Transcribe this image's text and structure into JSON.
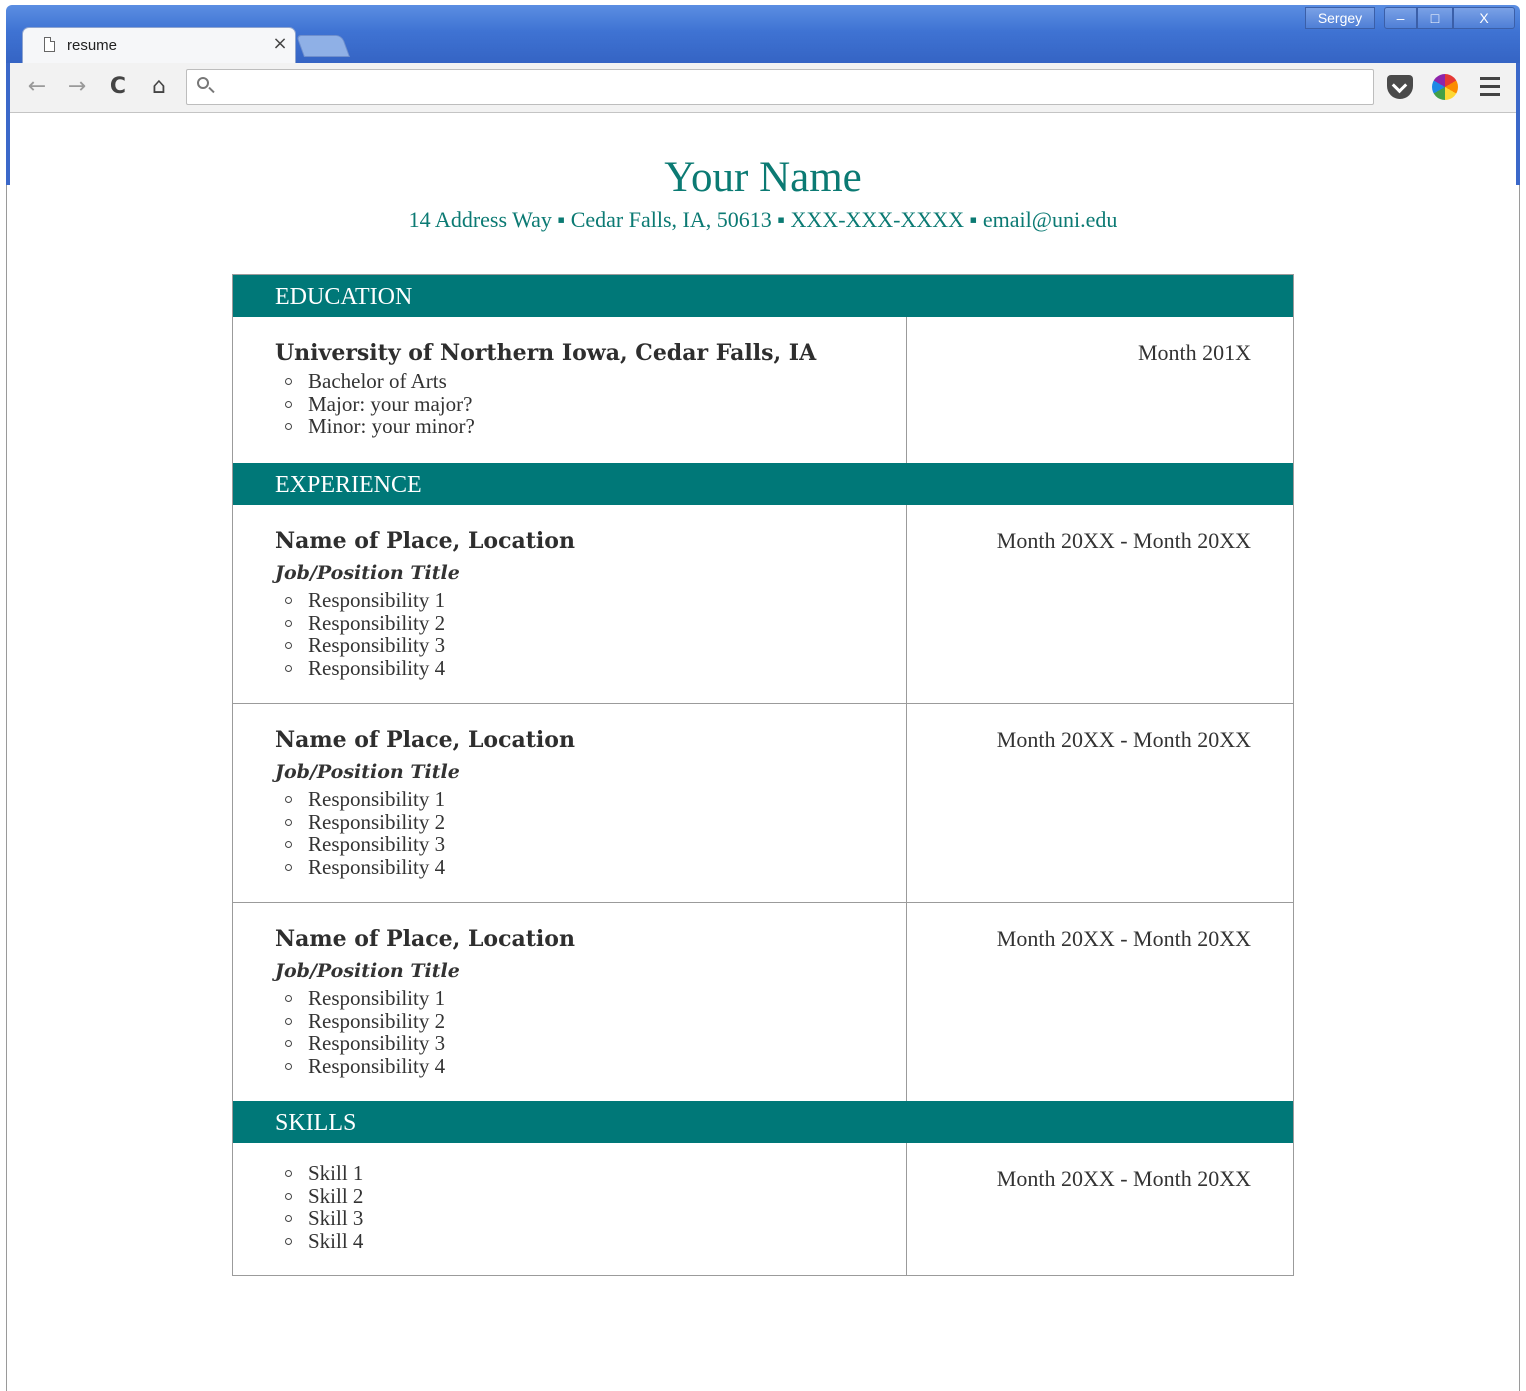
{
  "browser": {
    "tab_title": "resume",
    "tab_close": "×",
    "user_label": "Sergey",
    "min_label": "–",
    "max_label": "□",
    "close_label": "X",
    "back_glyph": "←",
    "forward_glyph": "→",
    "reload_glyph": "C",
    "home_glyph": "⌂",
    "address_value": "",
    "icons": [
      "page-icon",
      "search-icon",
      "pocket-icon",
      "color-picker-icon",
      "menu-icon"
    ]
  },
  "resume": {
    "name": "Your Name",
    "contact": "14 Address Way ▪ Cedar Falls, IA, 50613 ▪ XXX-XXX-XXXX ▪ email@uni.edu",
    "education": {
      "header": "EDUCATION",
      "school": "University of Northern Iowa, Cedar Falls, IA",
      "items": [
        "Bachelor of Arts",
        "Major: your major?",
        "Minor: your minor?"
      ],
      "date": "Month 201X"
    },
    "experience": {
      "header": "EXPERIENCE",
      "entries": [
        {
          "place": "Name of Place, Location",
          "title": "Job/Position Title",
          "items": [
            "Responsibility 1",
            "Responsibility 2",
            "Responsibility 3",
            "Responsibility 4"
          ],
          "date": "Month 20XX - Month 20XX"
        },
        {
          "place": "Name of Place, Location",
          "title": "Job/Position Title",
          "items": [
            "Responsibility 1",
            "Responsibility 2",
            "Responsibility 3",
            "Responsibility 4"
          ],
          "date": "Month 20XX - Month 20XX"
        },
        {
          "place": "Name of Place, Location",
          "title": "Job/Position Title",
          "items": [
            "Responsibility 1",
            "Responsibility 2",
            "Responsibility 3",
            "Responsibility 4"
          ],
          "date": "Month 20XX - Month 20XX"
        }
      ]
    },
    "skills": {
      "header": "SKILLS",
      "items": [
        "Skill 1",
        "Skill 2",
        "Skill 3",
        "Skill 4"
      ],
      "date": "Month 20XX - Month 20XX"
    }
  },
  "colors": {
    "accent": "#007878",
    "heading_text": "#0b7a73",
    "titlebar": "#3f73d3"
  }
}
